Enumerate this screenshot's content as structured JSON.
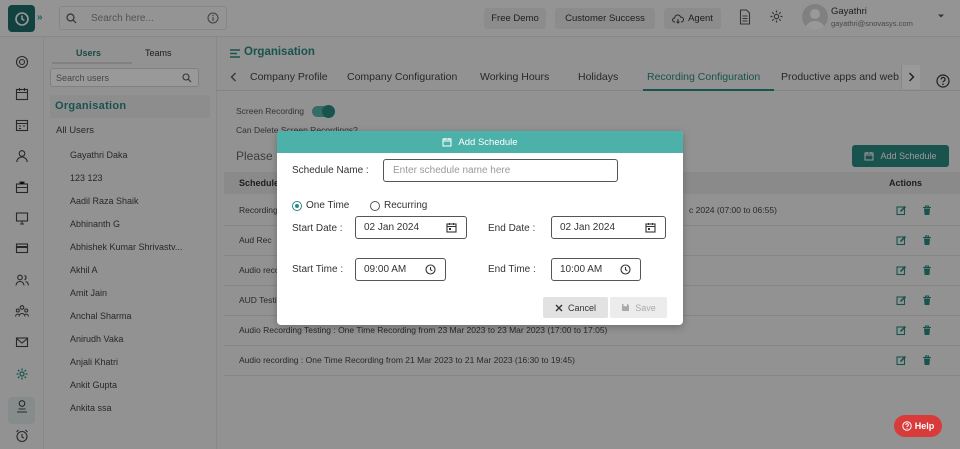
{
  "topbar": {
    "search_placeholder": "Search here...",
    "buttons": [
      "Free Demo",
      "Customer Success",
      "Agent"
    ],
    "user": {
      "name": "Gayathri",
      "email": "gayathri@snovasys.com"
    }
  },
  "userpanel": {
    "tabs": [
      "Users",
      "Teams"
    ],
    "search_placeholder": "Search users",
    "org_heading": "Organisation",
    "all_users": "All Users",
    "users": [
      "Gayathri Daka",
      "123 123",
      "Aadil Raza Shaik",
      "Abhinanth G",
      "Abhishek Kumar Shrivastv...",
      "Akhil A",
      "Amit Jain",
      "Anchal Sharma",
      "Anirudh Vaka",
      "Anjali Khatri",
      "Ankit Gupta",
      "Ankita ssa"
    ]
  },
  "main": {
    "title": "Organisation",
    "tabs": [
      "Company Profile",
      "Company Configuration",
      "Working Hours",
      "Holidays",
      "Recording Configuration",
      "Productive apps and web"
    ],
    "active_tab": "Recording Configuration",
    "screen_recording_label": "Screen Recording",
    "can_delete_label": "Can Delete Screen Recordings?",
    "please_label": "Please",
    "add_schedule_button": "Add Schedule",
    "table_headers": [
      "Schedule",
      "Actions"
    ],
    "rows": [
      {
        "text": "Recording",
        "right": "c 2024 (07:00 to 06:55)"
      },
      {
        "text": "Aud Rec",
        "right": ""
      },
      {
        "text": "Audio reco",
        "right": ""
      },
      {
        "text": "AUD Testi",
        "right": ""
      },
      {
        "text": "Audio Recording Testing : One Time Recording from 23 Mar 2023 to 23 Mar 2023 (17:00 to 17:05)",
        "right": ""
      },
      {
        "text": "Audio recording : One Time Recording from 21 Mar 2023 to 21 Mar 2023 (16:30 to 19:45)",
        "right": ""
      }
    ]
  },
  "modal": {
    "title": "Add Schedule",
    "schedule_name_label": "Schedule Name :",
    "schedule_name_placeholder": "Enter schedule name here",
    "one_time_label": "One Time",
    "recurring_label": "Recurring",
    "start_date_label": "Start Date :",
    "start_date_value": "02 Jan 2024",
    "end_date_label": "End Date :",
    "end_date_value": "02 Jan 2024",
    "start_time_label": "Start Time :",
    "start_time_value": "09:00 AM",
    "end_time_label": "End Time :",
    "end_time_value": "10:00 AM",
    "cancel_label": "Cancel",
    "save_label": "Save"
  },
  "help_button": "Help",
  "colors": {
    "accent": "#2b8a83",
    "modal_header": "#4cb1a9",
    "help": "#d93a3a"
  }
}
